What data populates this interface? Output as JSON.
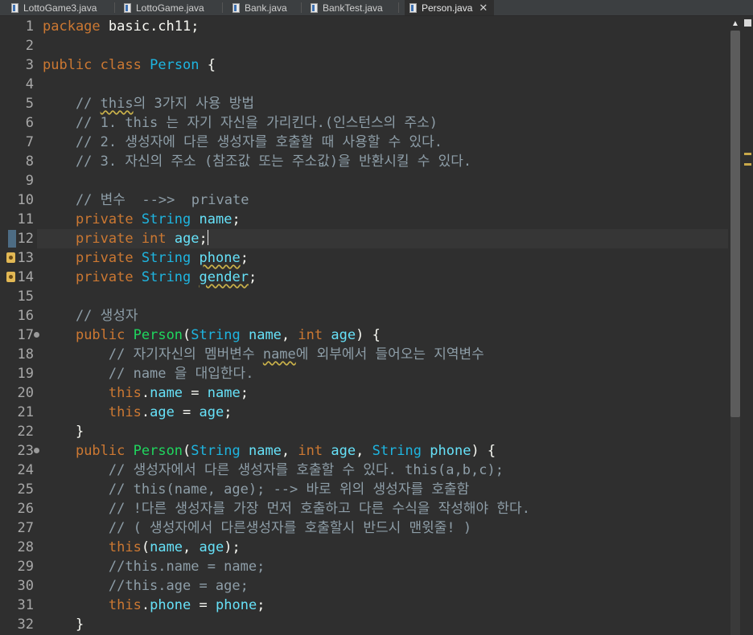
{
  "tabs": [
    {
      "label": "LottoGame3.java",
      "active": false
    },
    {
      "label": "LottoGame.java",
      "active": false
    },
    {
      "label": "Bank.java",
      "active": false
    },
    {
      "label": "BankTest.java",
      "active": false
    },
    {
      "label": "Person.java",
      "active": true
    }
  ],
  "close_glyph": "✕",
  "colors": {
    "background": "#2f2f2f",
    "keyword": "#cc7832",
    "type": "#1eb5e0",
    "field": "#66e1f8",
    "method": "#1fd65e",
    "comment": "#8e9ea8",
    "text": "#d9e8f7"
  },
  "editor": {
    "current_line": 12,
    "lines": [
      {
        "n": "1",
        "tokens": [
          [
            "kw",
            "package"
          ],
          [
            "pn",
            " basic.ch11;"
          ]
        ]
      },
      {
        "n": "2",
        "tokens": []
      },
      {
        "n": "3",
        "tokens": [
          [
            "kw",
            "public"
          ],
          [
            "pn",
            " "
          ],
          [
            "kw",
            "class"
          ],
          [
            "pn",
            " "
          ],
          [
            "cls",
            "Person"
          ],
          [
            "pn",
            " {"
          ]
        ]
      },
      {
        "n": "4",
        "tokens": []
      },
      {
        "n": "5",
        "tokens": [
          [
            "cm",
            "    // "
          ],
          [
            "cm sq",
            "this"
          ],
          [
            "cm",
            "의 3가지 사용 방법"
          ]
        ]
      },
      {
        "n": "6",
        "tokens": [
          [
            "cm",
            "    // 1. this 는 자기 자신을 가리킨다.(인스턴스의 주소)"
          ]
        ]
      },
      {
        "n": "7",
        "tokens": [
          [
            "cm",
            "    // 2. 생성자에 다른 생성자를 호출할 때 사용할 수 있다."
          ]
        ]
      },
      {
        "n": "8",
        "tokens": [
          [
            "cm",
            "    // 3. 자신의 주소 (참조값 또는 주소값)을 반환시킬 수 있다."
          ]
        ]
      },
      {
        "n": "9",
        "tokens": []
      },
      {
        "n": "10",
        "tokens": [
          [
            "cm",
            "    // 변수  -->>  private"
          ]
        ]
      },
      {
        "n": "11",
        "tokens": [
          [
            "pn",
            "    "
          ],
          [
            "kw",
            "private"
          ],
          [
            "pn",
            " "
          ],
          [
            "ty",
            "String"
          ],
          [
            "pn",
            " "
          ],
          [
            "id",
            "name"
          ],
          [
            "pn",
            ";"
          ]
        ]
      },
      {
        "n": "12",
        "tokens": [
          [
            "pn",
            "    "
          ],
          [
            "kw",
            "private"
          ],
          [
            "pn",
            " "
          ],
          [
            "kw",
            "int"
          ],
          [
            "pn",
            " "
          ],
          [
            "id",
            "age"
          ],
          [
            "pn",
            ";"
          ],
          [
            "caret",
            ""
          ]
        ]
      },
      {
        "n": "13",
        "tokens": [
          [
            "pn",
            "    "
          ],
          [
            "kw",
            "private"
          ],
          [
            "pn",
            " "
          ],
          [
            "ty",
            "String"
          ],
          [
            "pn",
            " "
          ],
          [
            "id sq",
            "phone"
          ],
          [
            "pn",
            ";"
          ]
        ]
      },
      {
        "n": "14",
        "tokens": [
          [
            "pn",
            "    "
          ],
          [
            "kw",
            "private"
          ],
          [
            "pn",
            " "
          ],
          [
            "ty",
            "String"
          ],
          [
            "pn",
            " "
          ],
          [
            "id sq",
            "gender"
          ],
          [
            "pn",
            ";"
          ]
        ]
      },
      {
        "n": "15",
        "tokens": []
      },
      {
        "n": "16",
        "tokens": [
          [
            "cm",
            "    // 생성자"
          ]
        ]
      },
      {
        "n": "17",
        "tokens": [
          [
            "pn",
            "    "
          ],
          [
            "kw",
            "public"
          ],
          [
            "pn",
            " "
          ],
          [
            "fn",
            "Person"
          ],
          [
            "pn",
            "("
          ],
          [
            "ty",
            "String"
          ],
          [
            "pn",
            " "
          ],
          [
            "id",
            "name"
          ],
          [
            "pn",
            ", "
          ],
          [
            "kw",
            "int"
          ],
          [
            "pn",
            " "
          ],
          [
            "id",
            "age"
          ],
          [
            "pn",
            ") {"
          ]
        ]
      },
      {
        "n": "18",
        "tokens": [
          [
            "cm",
            "        // 자기자신의 멤버변수 "
          ],
          [
            "cm sq",
            "name"
          ],
          [
            "cm",
            "에 외부에서 들어오는 지역변수"
          ]
        ]
      },
      {
        "n": "19",
        "tokens": [
          [
            "cm",
            "        // name 을 대입한다."
          ]
        ]
      },
      {
        "n": "20",
        "tokens": [
          [
            "pn",
            "        "
          ],
          [
            "this",
            "this"
          ],
          [
            "pn",
            "."
          ],
          [
            "id",
            "name"
          ],
          [
            "pn",
            " = "
          ],
          [
            "id",
            "name"
          ],
          [
            "pn",
            ";"
          ]
        ]
      },
      {
        "n": "21",
        "tokens": [
          [
            "pn",
            "        "
          ],
          [
            "this",
            "this"
          ],
          [
            "pn",
            "."
          ],
          [
            "id",
            "age"
          ],
          [
            "pn",
            " = "
          ],
          [
            "id",
            "age"
          ],
          [
            "pn",
            ";"
          ]
        ]
      },
      {
        "n": "22",
        "tokens": [
          [
            "pn",
            "    }"
          ]
        ]
      },
      {
        "n": "23",
        "tokens": [
          [
            "pn",
            "    "
          ],
          [
            "kw",
            "public"
          ],
          [
            "pn",
            " "
          ],
          [
            "fn",
            "Person"
          ],
          [
            "pn",
            "("
          ],
          [
            "ty",
            "String"
          ],
          [
            "pn",
            " "
          ],
          [
            "id",
            "name"
          ],
          [
            "pn",
            ", "
          ],
          [
            "kw",
            "int"
          ],
          [
            "pn",
            " "
          ],
          [
            "id",
            "age"
          ],
          [
            "pn",
            ", "
          ],
          [
            "ty",
            "String"
          ],
          [
            "pn",
            " "
          ],
          [
            "id",
            "phone"
          ],
          [
            "pn",
            ") {"
          ]
        ]
      },
      {
        "n": "24",
        "tokens": [
          [
            "cm",
            "        // 생성자에서 다른 생성자를 호출할 수 있다. this(a,b,c);"
          ]
        ]
      },
      {
        "n": "25",
        "tokens": [
          [
            "cm",
            "        // this(name, age); --> 바로 위의 생성자를 호출함"
          ]
        ]
      },
      {
        "n": "26",
        "tokens": [
          [
            "cm",
            "        // !다른 생성자를 가장 먼저 호출하고 다른 수식을 작성해야 한다."
          ]
        ]
      },
      {
        "n": "27",
        "tokens": [
          [
            "cm",
            "        // ( 생성자에서 다른생성자를 호출할시 반드시 맨윗줄! )"
          ]
        ]
      },
      {
        "n": "28",
        "tokens": [
          [
            "pn",
            "        "
          ],
          [
            "this",
            "this"
          ],
          [
            "pn",
            "("
          ],
          [
            "id",
            "name"
          ],
          [
            "pn",
            ", "
          ],
          [
            "id",
            "age"
          ],
          [
            "pn",
            ");"
          ]
        ]
      },
      {
        "n": "29",
        "tokens": [
          [
            "cm",
            "        //this.name = name;"
          ]
        ]
      },
      {
        "n": "30",
        "tokens": [
          [
            "cm",
            "        //this.age = age;"
          ]
        ]
      },
      {
        "n": "31",
        "tokens": [
          [
            "pn",
            "        "
          ],
          [
            "this",
            "this"
          ],
          [
            "pn",
            "."
          ],
          [
            "id",
            "phone"
          ],
          [
            "pn",
            " = "
          ],
          [
            "id",
            "phone"
          ],
          [
            "pn",
            ";"
          ]
        ]
      },
      {
        "n": "32",
        "tokens": [
          [
            "pn",
            "    }"
          ]
        ]
      }
    ],
    "fold_lines": [
      "17",
      "23"
    ],
    "warning_lines": [
      "13",
      "14"
    ],
    "changed_lines": [
      "12"
    ]
  },
  "scrollbar": {
    "up_arrow": "▲",
    "thumb_fraction": 0.64
  }
}
